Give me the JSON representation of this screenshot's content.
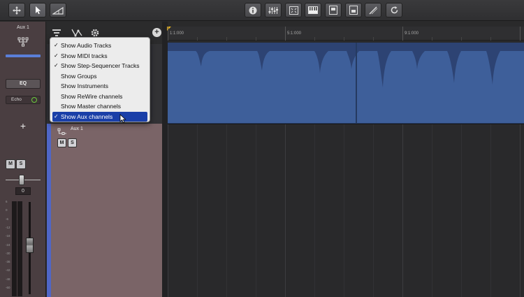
{
  "toolbar": {
    "left_tools": [
      {
        "icon": "move-arrows-icon"
      },
      {
        "icon": "pointer-icon",
        "active": true
      },
      {
        "icon": "automation-ramp-icon"
      }
    ],
    "center_tools": [
      {
        "icon": "info-icon"
      },
      {
        "icon": "mixer-icon"
      },
      {
        "icon": "editor-icon"
      },
      {
        "icon": "keyboard-icon"
      },
      {
        "icon": "browser-icon"
      },
      {
        "icon": "sound-bank-icon"
      },
      {
        "icon": "tuner-icon"
      },
      {
        "icon": "loop-icon"
      }
    ]
  },
  "channel_strip": {
    "name": "Aux 1",
    "eq_label": "EQ",
    "effect_name": "Echo",
    "add_label": "+",
    "mute_label": "M",
    "solo_label": "S",
    "pan_value": "0",
    "meter_scale": [
      "6",
      "0",
      "-6",
      "-12",
      "-18",
      "-24",
      "-30",
      "-36",
      "-42",
      "-48",
      "-60"
    ],
    "fader_level": 0.6,
    "accent_color": "#5a7fd8"
  },
  "track_list": {
    "aux_track": {
      "name": "Aux 1",
      "mute_label": "M",
      "solo_label": "S",
      "color": "#7a6467"
    }
  },
  "ruler": {
    "labels": [
      "1:1:000",
      "5:1:000",
      "9:1:000"
    ]
  },
  "view_menu": {
    "items": [
      {
        "label": "Show Audio Tracks",
        "checked": true,
        "selected": false
      },
      {
        "label": "Show MIDI tracks",
        "checked": true,
        "selected": false
      },
      {
        "label": "Show Step-Sequencer Tracks",
        "checked": true,
        "selected": false
      },
      {
        "label": "Show Groups",
        "checked": false,
        "selected": false
      },
      {
        "label": "Show Instruments",
        "checked": false,
        "selected": false
      },
      {
        "label": "Show ReWire channels",
        "checked": false,
        "selected": false
      },
      {
        "label": "Show Master channels",
        "checked": false,
        "selected": false
      },
      {
        "label": "Show Aux channels",
        "checked": true,
        "selected": true
      }
    ],
    "check_glyph": "✓"
  },
  "colors": {
    "clip_blue": "#3e5f9a",
    "aux_lane": "#7a6467",
    "selection": "#1a3fa8"
  }
}
